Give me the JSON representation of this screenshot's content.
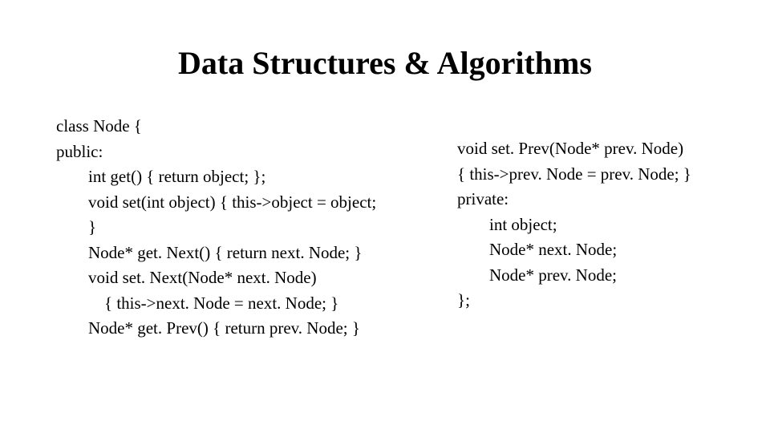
{
  "title": "Data Structures & Algorithms",
  "left": {
    "l0": "class Node {",
    "l1": "public:",
    "l2": "int get() { return object; };",
    "l3": "void set(int object) { this->object = object;",
    "l4": "}",
    "l5": "Node* get. Next() { return next. Node; }",
    "l6": "void set. Next(Node* next. Node)",
    "l7": "{ this->next. Node = next. Node; }",
    "l8": "Node* get. Prev() { return prev. Node; }"
  },
  "right": {
    "r0": "void set. Prev(Node* prev. Node)",
    "r1": "{ this->prev. Node = prev. Node; }",
    "r2": "private:",
    "r3": "int object;",
    "r4": "Node* next. Node;",
    "r5": "Node* prev. Node;",
    "r6": "};"
  }
}
